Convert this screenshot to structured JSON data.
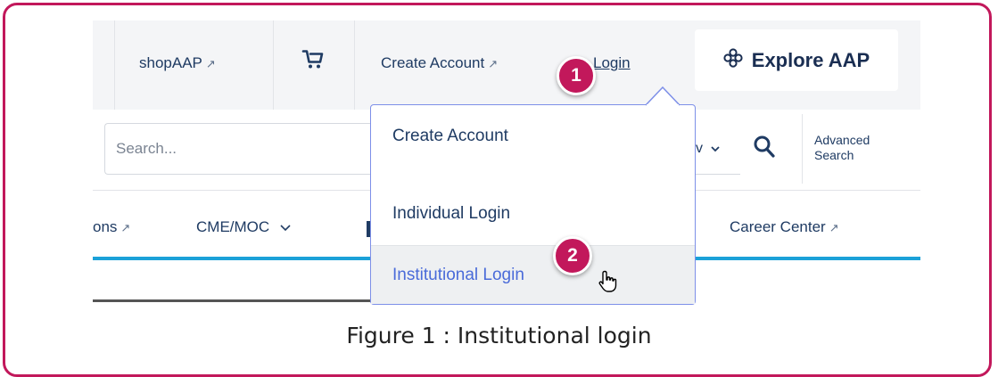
{
  "topbar": {
    "shop_label": "shopAAP",
    "external_glyph": "↗",
    "cart_icon": "cart-icon",
    "create_account_label": "Create Account",
    "login_label": "Login",
    "explore_label": "Explore AAP",
    "explore_icon": "clover-icon"
  },
  "search": {
    "placeholder": "Search...",
    "filter_fragment": "v",
    "advanced_line1": "Advanced",
    "advanced_line2": "Search"
  },
  "nav": {
    "items": [
      {
        "label": "ons"
      },
      {
        "label": "CME/MOC"
      },
      {
        "label": "Career Center"
      }
    ]
  },
  "dropdown": {
    "items": [
      {
        "label": "Create Account"
      },
      {
        "label": "Individual Login"
      },
      {
        "label": "Institutional Login"
      }
    ]
  },
  "annotations": {
    "badge1": "1",
    "badge2": "2",
    "color": "#c2185b"
  },
  "caption": "Figure 1 : Institutional login"
}
